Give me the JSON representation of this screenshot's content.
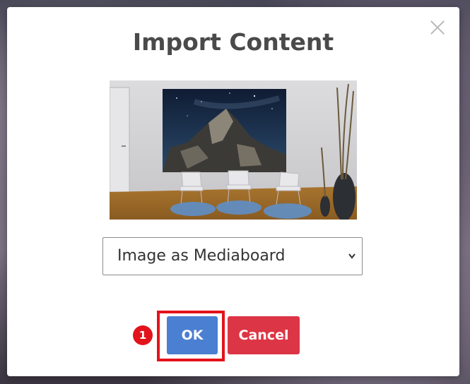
{
  "dialog": {
    "title": "Import Content",
    "preview_alt": "Room preview with mediaboard image",
    "select": {
      "value": "Image as Mediaboard"
    },
    "buttons": {
      "ok": "OK",
      "cancel": "Cancel"
    },
    "callout_number": "1"
  },
  "colors": {
    "ok": "#4a7fd1",
    "cancel": "#dc3545",
    "callout": "#e3131b",
    "title": "#4a4a4a"
  },
  "icons": [
    "close-icon",
    "chevron-down-icon"
  ]
}
